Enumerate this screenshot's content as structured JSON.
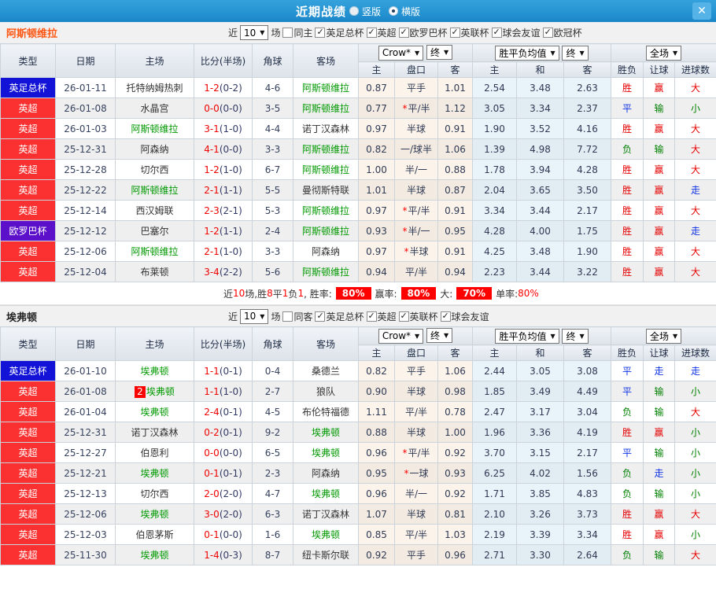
{
  "topbar": {
    "title": "近期战绩",
    "close_glyph": "✕",
    "radios": [
      {
        "label": "竖版",
        "checked": false
      },
      {
        "label": "横版",
        "checked": true
      }
    ]
  },
  "columns": {
    "type": "类型",
    "date": "日期",
    "home": "主场",
    "score": "比分(半场)",
    "corner": "角球",
    "away": "客场",
    "crow_select": "Crow*",
    "final_select": "终",
    "avg_select": "胜平负均值",
    "full_select": "全场",
    "sub": [
      "主",
      "盘口",
      "客",
      "主",
      "和",
      "客",
      "胜负",
      "让球",
      "进球数"
    ]
  },
  "sections": [
    {
      "team": "阿斯顿维拉",
      "filter": {
        "near": "近",
        "games": "10",
        "suffix": "场",
        "same_label": "同主",
        "same_checked": false,
        "leagues": [
          "英足总杯",
          "英超",
          "欧罗巴杯",
          "英联杯",
          "球会友谊",
          "欧冠杯"
        ]
      },
      "rows": [
        {
          "comp": "英足总杯",
          "comp_class": "blue",
          "date": "26-01-11",
          "home": "托特纳姆热刺",
          "home_green": false,
          "ft": "1-2",
          "ht": "(0-2)",
          "corner": "4-6",
          "away": "阿斯顿维拉",
          "away_green": true,
          "o1": "0.87",
          "hcap": "平手",
          "hcap_star": false,
          "o2": "1.01",
          "a1": "2.54",
          "a2": "3.48",
          "a3": "2.63",
          "r1": "胜",
          "r1c": "red",
          "r2": "赢",
          "r2c": "red",
          "r3": "大",
          "r3c": "red"
        },
        {
          "comp": "英超",
          "comp_class": "red",
          "date": "26-01-08",
          "home": "水晶宫",
          "home_green": false,
          "ft": "0-0",
          "ht": "(0-0)",
          "corner": "3-5",
          "away": "阿斯顿维拉",
          "away_green": true,
          "o1": "0.77",
          "hcap": "平/半",
          "hcap_star": true,
          "o2": "1.12",
          "a1": "3.05",
          "a2": "3.34",
          "a3": "2.37",
          "r1": "平",
          "r1c": "blue",
          "r2": "输",
          "r2c": "green",
          "r3": "小",
          "r3c": "green"
        },
        {
          "comp": "英超",
          "comp_class": "red",
          "date": "26-01-03",
          "home": "阿斯顿维拉",
          "home_green": true,
          "ft": "3-1",
          "ht": "(1-0)",
          "corner": "4-4",
          "away": "诺丁汉森林",
          "away_green": false,
          "o1": "0.97",
          "hcap": "半球",
          "hcap_star": false,
          "o2": "0.91",
          "a1": "1.90",
          "a2": "3.52",
          "a3": "4.16",
          "r1": "胜",
          "r1c": "red",
          "r2": "赢",
          "r2c": "red",
          "r3": "大",
          "r3c": "red"
        },
        {
          "comp": "英超",
          "comp_class": "red",
          "date": "25-12-31",
          "home": "阿森纳",
          "home_green": false,
          "ft": "4-1",
          "ht": "(0-0)",
          "corner": "3-3",
          "away": "阿斯顿维拉",
          "away_green": true,
          "o1": "0.82",
          "hcap": "一/球半",
          "hcap_star": false,
          "o2": "1.06",
          "a1": "1.39",
          "a2": "4.98",
          "a3": "7.72",
          "r1": "负",
          "r1c": "green",
          "r2": "输",
          "r2c": "green",
          "r3": "大",
          "r3c": "red"
        },
        {
          "comp": "英超",
          "comp_class": "red",
          "date": "25-12-28",
          "home": "切尔西",
          "home_green": false,
          "ft": "1-2",
          "ht": "(1-0)",
          "corner": "6-7",
          "away": "阿斯顿维拉",
          "away_green": true,
          "o1": "1.00",
          "hcap": "半/一",
          "hcap_star": false,
          "o2": "0.88",
          "a1": "1.78",
          "a2": "3.94",
          "a3": "4.28",
          "r1": "胜",
          "r1c": "red",
          "r2": "赢",
          "r2c": "red",
          "r3": "大",
          "r3c": "red"
        },
        {
          "comp": "英超",
          "comp_class": "red",
          "date": "25-12-22",
          "home": "阿斯顿维拉",
          "home_green": true,
          "ft": "2-1",
          "ht": "(1-1)",
          "corner": "5-5",
          "away": "曼彻斯特联",
          "away_green": false,
          "o1": "1.01",
          "hcap": "半球",
          "hcap_star": false,
          "o2": "0.87",
          "a1": "2.04",
          "a2": "3.65",
          "a3": "3.50",
          "r1": "胜",
          "r1c": "red",
          "r2": "赢",
          "r2c": "red",
          "r3": "走",
          "r3c": "blue"
        },
        {
          "comp": "英超",
          "comp_class": "red",
          "date": "25-12-14",
          "home": "西汉姆联",
          "home_green": false,
          "ft": "2-3",
          "ht": "(2-1)",
          "corner": "5-3",
          "away": "阿斯顿维拉",
          "away_green": true,
          "o1": "0.97",
          "hcap": "平/半",
          "hcap_star": true,
          "o2": "0.91",
          "a1": "3.34",
          "a2": "3.44",
          "a3": "2.17",
          "r1": "胜",
          "r1c": "red",
          "r2": "赢",
          "r2c": "red",
          "r3": "大",
          "r3c": "red"
        },
        {
          "comp": "欧罗巴杯",
          "comp_class": "purple",
          "date": "25-12-12",
          "home": "巴塞尔",
          "home_green": false,
          "ft": "1-2",
          "ht": "(1-1)",
          "corner": "2-4",
          "away": "阿斯顿维拉",
          "away_green": true,
          "o1": "0.93",
          "hcap": "半/一",
          "hcap_star": true,
          "o2": "0.95",
          "a1": "4.28",
          "a2": "4.00",
          "a3": "1.75",
          "r1": "胜",
          "r1c": "red",
          "r2": "赢",
          "r2c": "red",
          "r3": "走",
          "r3c": "blue"
        },
        {
          "comp": "英超",
          "comp_class": "red",
          "date": "25-12-06",
          "home": "阿斯顿维拉",
          "home_green": true,
          "ft": "2-1",
          "ht": "(1-0)",
          "corner": "3-3",
          "away": "阿森纳",
          "away_green": false,
          "o1": "0.97",
          "hcap": "半球",
          "hcap_star": true,
          "o2": "0.91",
          "a1": "4.25",
          "a2": "3.48",
          "a3": "1.90",
          "r1": "胜",
          "r1c": "red",
          "r2": "赢",
          "r2c": "red",
          "r3": "大",
          "r3c": "red"
        },
        {
          "comp": "英超",
          "comp_class": "red",
          "date": "25-12-04",
          "home": "布莱顿",
          "home_green": false,
          "ft": "3-4",
          "ht": "(2-2)",
          "corner": "5-6",
          "away": "阿斯顿维拉",
          "away_green": true,
          "o1": "0.94",
          "hcap": "平/半",
          "hcap_star": false,
          "o2": "0.94",
          "a1": "2.23",
          "a2": "3.44",
          "a3": "3.22",
          "r1": "胜",
          "r1c": "red",
          "r2": "赢",
          "r2c": "red",
          "r3": "大",
          "r3c": "red"
        }
      ],
      "summary": {
        "near": "近",
        "n": "10",
        "seg1": "场,胜",
        "w": "8",
        "seg2": "平",
        "d": "1",
        "seg3": "负",
        "l": "1",
        "seg4": ", 胜率:",
        "win_rate": "80%",
        "seg5": "赢率:",
        "odds_rate": "80%",
        "seg6": "大:",
        "big_rate": "70%",
        "seg7": "单率:",
        "single_rate": "80%"
      }
    },
    {
      "team": "埃弗顿",
      "filter": {
        "near": "近",
        "games": "10",
        "suffix": "场",
        "same_label": "同客",
        "same_checked": false,
        "leagues": [
          "英足总杯",
          "英超",
          "英联杯",
          "球会友谊"
        ]
      },
      "rows": [
        {
          "comp": "英足总杯",
          "comp_class": "blue",
          "date": "26-01-10",
          "home": "埃弗顿",
          "home_green": true,
          "ft": "1-1",
          "ht": "(0-1)",
          "corner": "0-4",
          "away": "桑德兰",
          "away_green": false,
          "o1": "0.82",
          "hcap": "平手",
          "hcap_star": false,
          "o2": "1.06",
          "a1": "2.44",
          "a2": "3.05",
          "a3": "3.08",
          "r1": "平",
          "r1c": "blue",
          "r2": "走",
          "r2c": "blue",
          "r3": "走",
          "r3c": "blue"
        },
        {
          "comp": "英超",
          "comp_class": "red",
          "date": "26-01-08",
          "home": "埃弗顿",
          "home_green": true,
          "home_badge": "2",
          "ft": "1-1",
          "ht": "(1-0)",
          "corner": "2-7",
          "away": "狼队",
          "away_green": false,
          "o1": "0.90",
          "hcap": "半球",
          "hcap_star": false,
          "o2": "0.98",
          "a1": "1.85",
          "a2": "3.49",
          "a3": "4.49",
          "r1": "平",
          "r1c": "blue",
          "r2": "输",
          "r2c": "green",
          "r3": "小",
          "r3c": "green"
        },
        {
          "comp": "英超",
          "comp_class": "red",
          "date": "26-01-04",
          "home": "埃弗顿",
          "home_green": true,
          "ft": "2-4",
          "ht": "(0-1)",
          "corner": "4-5",
          "away": "布伦特福德",
          "away_green": false,
          "o1": "1.11",
          "hcap": "平/半",
          "hcap_star": false,
          "o2": "0.78",
          "a1": "2.47",
          "a2": "3.17",
          "a3": "3.04",
          "r1": "负",
          "r1c": "green",
          "r2": "输",
          "r2c": "green",
          "r3": "大",
          "r3c": "red"
        },
        {
          "comp": "英超",
          "comp_class": "red",
          "date": "25-12-31",
          "home": "诺丁汉森林",
          "home_green": false,
          "ft": "0-2",
          "ht": "(0-1)",
          "corner": "9-2",
          "away": "埃弗顿",
          "away_green": true,
          "o1": "0.88",
          "hcap": "半球",
          "hcap_star": false,
          "o2": "1.00",
          "a1": "1.96",
          "a2": "3.36",
          "a3": "4.19",
          "r1": "胜",
          "r1c": "red",
          "r2": "赢",
          "r2c": "red",
          "r3": "小",
          "r3c": "green"
        },
        {
          "comp": "英超",
          "comp_class": "red",
          "date": "25-12-27",
          "home": "伯恩利",
          "home_green": false,
          "ft": "0-0",
          "ht": "(0-0)",
          "corner": "6-5",
          "away": "埃弗顿",
          "away_green": true,
          "o1": "0.96",
          "hcap": "平/半",
          "hcap_star": true,
          "o2": "0.92",
          "a1": "3.70",
          "a2": "3.15",
          "a3": "2.17",
          "r1": "平",
          "r1c": "blue",
          "r2": "输",
          "r2c": "green",
          "r3": "小",
          "r3c": "green"
        },
        {
          "comp": "英超",
          "comp_class": "red",
          "date": "25-12-21",
          "home": "埃弗顿",
          "home_green": true,
          "ft": "0-1",
          "ht": "(0-1)",
          "corner": "2-3",
          "away": "阿森纳",
          "away_green": false,
          "o1": "0.95",
          "hcap": "一球",
          "hcap_star": true,
          "o2": "0.93",
          "a1": "6.25",
          "a2": "4.02",
          "a3": "1.56",
          "r1": "负",
          "r1c": "green",
          "r2": "走",
          "r2c": "blue",
          "r3": "小",
          "r3c": "green"
        },
        {
          "comp": "英超",
          "comp_class": "red",
          "date": "25-12-13",
          "home": "切尔西",
          "home_green": false,
          "ft": "2-0",
          "ht": "(2-0)",
          "corner": "4-7",
          "away": "埃弗顿",
          "away_green": true,
          "o1": "0.96",
          "hcap": "半/一",
          "hcap_star": false,
          "o2": "0.92",
          "a1": "1.71",
          "a2": "3.85",
          "a3": "4.83",
          "r1": "负",
          "r1c": "green",
          "r2": "输",
          "r2c": "green",
          "r3": "小",
          "r3c": "green"
        },
        {
          "comp": "英超",
          "comp_class": "red",
          "date": "25-12-06",
          "home": "埃弗顿",
          "home_green": true,
          "ft": "3-0",
          "ht": "(2-0)",
          "corner": "6-3",
          "away": "诺丁汉森林",
          "away_green": false,
          "o1": "1.07",
          "hcap": "半球",
          "hcap_star": false,
          "o2": "0.81",
          "a1": "2.10",
          "a2": "3.26",
          "a3": "3.73",
          "r1": "胜",
          "r1c": "red",
          "r2": "赢",
          "r2c": "red",
          "r3": "大",
          "r3c": "red"
        },
        {
          "comp": "英超",
          "comp_class": "red",
          "date": "25-12-03",
          "home": "伯恩茅斯",
          "home_green": false,
          "ft": "0-1",
          "ht": "(0-0)",
          "corner": "1-6",
          "away": "埃弗顿",
          "away_green": true,
          "o1": "0.85",
          "hcap": "平/半",
          "hcap_star": false,
          "o2": "1.03",
          "a1": "2.19",
          "a2": "3.39",
          "a3": "3.34",
          "r1": "胜",
          "r1c": "red",
          "r2": "赢",
          "r2c": "red",
          "r3": "小",
          "r3c": "green"
        },
        {
          "comp": "英超",
          "comp_class": "red",
          "date": "25-11-30",
          "home": "埃弗顿",
          "home_green": true,
          "ft": "1-4",
          "ht": "(0-3)",
          "corner": "8-7",
          "away": "纽卡斯尔联",
          "away_green": false,
          "o1": "0.92",
          "hcap": "平手",
          "hcap_star": false,
          "o2": "0.96",
          "a1": "2.71",
          "a2": "3.30",
          "a3": "2.64",
          "r1": "负",
          "r1c": "green",
          "r2": "输",
          "r2c": "green",
          "r3": "大",
          "r3c": "red"
        }
      ]
    }
  ]
}
